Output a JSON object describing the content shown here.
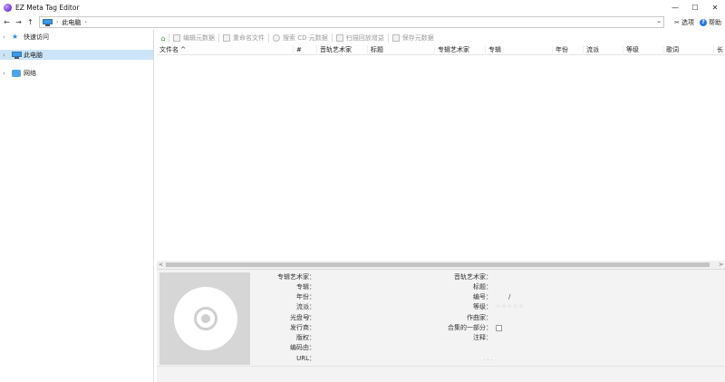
{
  "window": {
    "title": "EZ Meta Tag Editor",
    "minimize": "—",
    "maximize": "☐",
    "close": "✕"
  },
  "nav": {
    "back": "←",
    "forward": "→",
    "up": "↑",
    "address": "此电脑",
    "address_sep": "›",
    "dropdown": "⌄"
  },
  "right_tools": {
    "options_label": "选项",
    "help_label": "帮助",
    "options_icon": "scissors-icon",
    "help_icon": "help-icon"
  },
  "tree": {
    "items": [
      {
        "label": "快速访问",
        "icon": "star-icon",
        "selected": false
      },
      {
        "label": "此电脑",
        "icon": "computer-icon",
        "selected": true
      },
      {
        "label": "网络",
        "icon": "network-icon",
        "selected": false
      }
    ]
  },
  "toolbar": {
    "items": [
      {
        "label": "编辑元数据"
      },
      {
        "label": "重命名文件"
      },
      {
        "label": "搜索 CD 元数据"
      },
      {
        "label": "扫描回放增益"
      },
      {
        "label": "保存元数据"
      }
    ]
  },
  "columns": [
    {
      "label": "文件名 ^"
    },
    {
      "label": "#"
    },
    {
      "label": "音轨艺术家"
    },
    {
      "label": "标题"
    },
    {
      "label": "专辑艺术家"
    },
    {
      "label": "专辑"
    },
    {
      "label": "年份"
    },
    {
      "label": "流派"
    },
    {
      "label": "等级"
    },
    {
      "label": "歌词"
    },
    {
      "label": "长"
    }
  ],
  "scroll": {
    "left": "<",
    "right": ">"
  },
  "details": {
    "left_fields": [
      {
        "label": "专辑艺术家：",
        "value": ""
      },
      {
        "label": "专辑：",
        "value": ""
      },
      {
        "label": "年份：",
        "value": ""
      },
      {
        "label": "流派：",
        "value": ""
      },
      {
        "label": "光盘号：",
        "value": "/"
      },
      {
        "label": "发行商：",
        "value": ""
      },
      {
        "label": "版权：",
        "value": ""
      },
      {
        "label": "编码由：",
        "value": ""
      },
      {
        "label": "URL：",
        "value": ""
      }
    ],
    "right_fields": [
      {
        "label": "音轨艺术家：",
        "value": ""
      },
      {
        "label": "标题：",
        "value": ""
      },
      {
        "label": "编号：",
        "value": "/"
      },
      {
        "label": "等级：",
        "value": ""
      },
      {
        "label": "作曲家：",
        "value": ""
      },
      {
        "label": "合集的一部分：",
        "value": ""
      },
      {
        "label": "注释：",
        "value": ""
      }
    ],
    "rating_stars": "☆☆☆☆☆",
    "resize_grip": "· · ·"
  },
  "colors": {
    "selection": "#cce4f7",
    "accent": "#2b7bd8"
  }
}
